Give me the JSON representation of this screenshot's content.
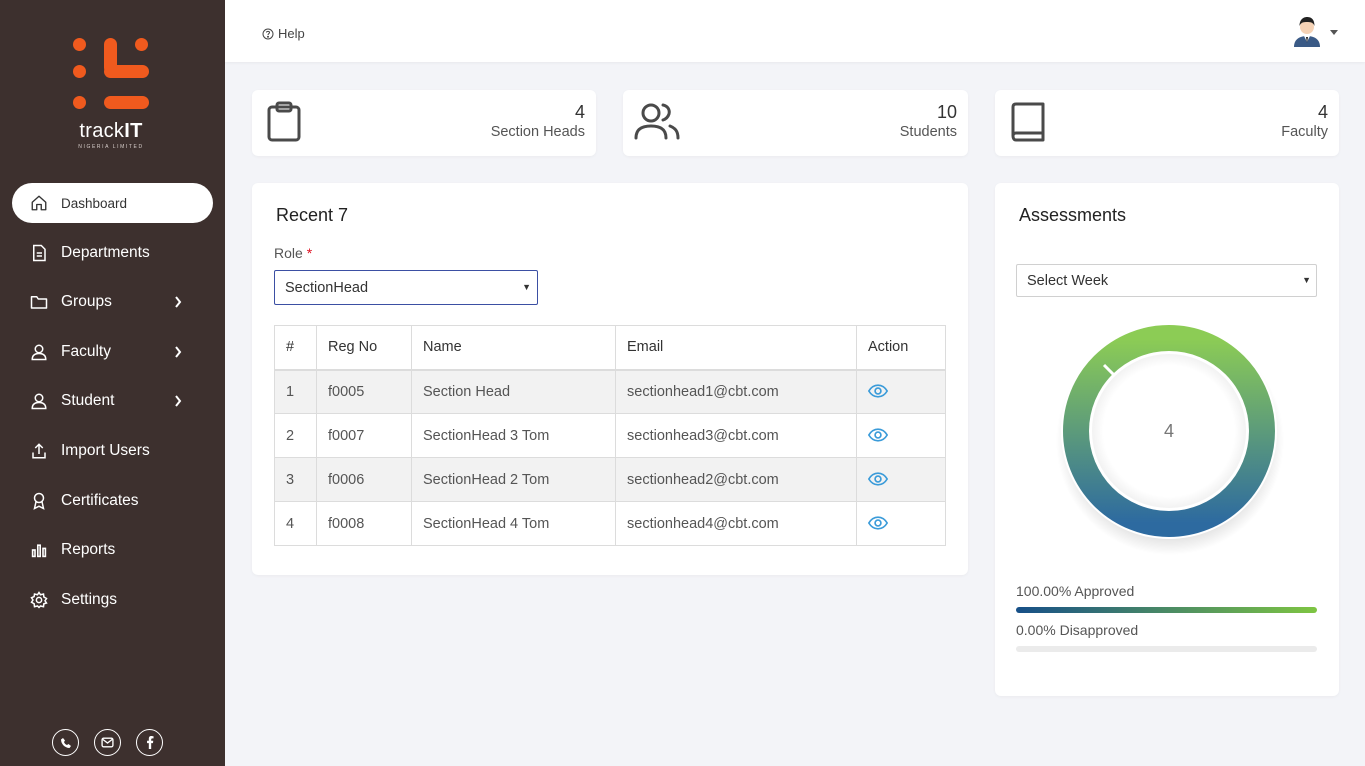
{
  "brand": {
    "name_prefix": "track",
    "name_suffix": "IT",
    "subtitle": "NIGERIA LIMITED",
    "colors": {
      "logo": "#f05a1e",
      "sidebar": "#3d302e"
    }
  },
  "topbar": {
    "help_label": "Help"
  },
  "sidebar": {
    "items": [
      {
        "label": "Dashboard",
        "icon": "home-icon",
        "active": true
      },
      {
        "label": "Departments",
        "icon": "document-icon"
      },
      {
        "label": "Groups",
        "icon": "folder-icon",
        "has_children": true
      },
      {
        "label": "Faculty",
        "icon": "user-icon",
        "has_children": true
      },
      {
        "label": "Student",
        "icon": "user-icon",
        "has_children": true
      },
      {
        "label": "Import Users",
        "icon": "upload-icon"
      },
      {
        "label": "Certificates",
        "icon": "award-icon"
      },
      {
        "label": "Reports",
        "icon": "bar-chart-icon"
      },
      {
        "label": "Settings",
        "icon": "gear-icon"
      }
    ],
    "social": [
      "phone-icon",
      "mail-icon",
      "facebook-icon"
    ]
  },
  "stats": [
    {
      "value": "4",
      "label": "Section Heads",
      "icon": "clipboard-icon"
    },
    {
      "value": "10",
      "label": "Students",
      "icon": "users-icon"
    },
    {
      "value": "4",
      "label": "Faculty",
      "icon": "book-icon"
    }
  ],
  "recent": {
    "title": "Recent 7",
    "role_label": "Role",
    "required_mark": "*",
    "role_value": "SectionHead",
    "columns": [
      "#",
      "Reg No",
      "Name",
      "Email",
      "Action"
    ],
    "rows": [
      {
        "num": "1",
        "reg": "f0005",
        "name": "Section Head",
        "email": "sectionhead1@cbt.com"
      },
      {
        "num": "2",
        "reg": "f0007",
        "name": "SectionHead 3 Tom",
        "email": "sectionhead3@cbt.com"
      },
      {
        "num": "3",
        "reg": "f0006",
        "name": "SectionHead 2 Tom",
        "email": "sectionhead2@cbt.com"
      },
      {
        "num": "4",
        "reg": "f0008",
        "name": "SectionHead 4 Tom",
        "email": "sectionhead4@cbt.com"
      }
    ],
    "action_icon": "eye-icon",
    "action_color": "#3a9bd9"
  },
  "assessments": {
    "title": "Assessments",
    "week_placeholder": "Select Week",
    "donut_center": "4",
    "approved_label": "100.00% Approved",
    "approved_fraction": 1.0,
    "disapproved_label": "0.00% Disapproved",
    "disapproved_fraction": 0.0,
    "gradient": [
      "#8ccc55",
      "#2d6aa0"
    ]
  }
}
